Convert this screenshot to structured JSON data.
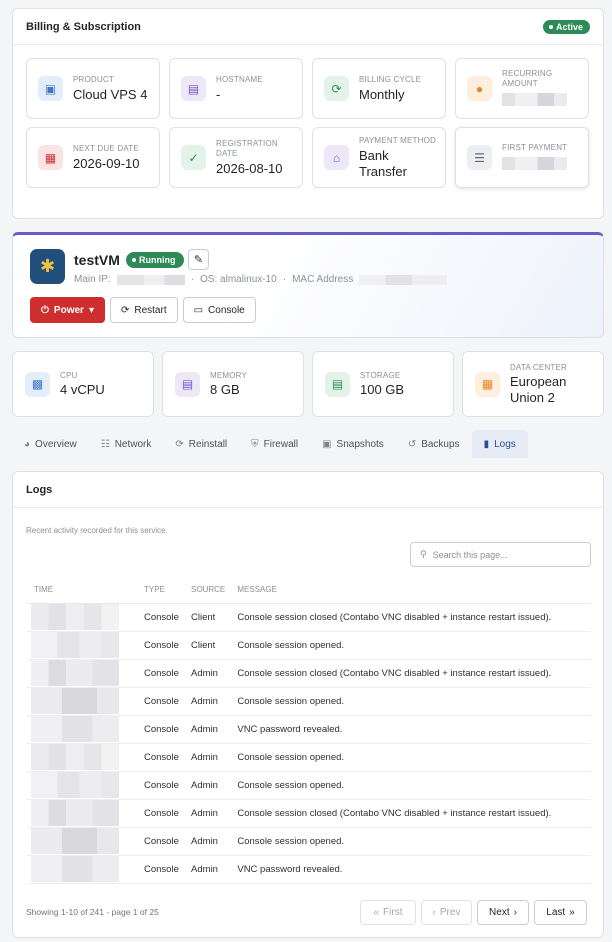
{
  "billing": {
    "title": "Billing & Subscription",
    "status": "Active",
    "items": [
      {
        "label": "PRODUCT",
        "value": "Cloud VPS 4",
        "icon": "cube-icon"
      },
      {
        "label": "HOSTNAME",
        "value": "-",
        "icon": "server-icon"
      },
      {
        "label": "BILLING CYCLE",
        "value": "Monthly",
        "icon": "refresh-icon"
      },
      {
        "label": "RECURRING AMOUNT",
        "value": "",
        "icon": "coins-icon"
      },
      {
        "label": "NEXT DUE DATE",
        "value": "2026-09-10",
        "icon": "calendar-icon"
      },
      {
        "label": "REGISTRATION DATE",
        "value": "2026-08-10",
        "icon": "calendar-check-icon"
      },
      {
        "label": "PAYMENT METHOD",
        "value": "Bank Transfer",
        "icon": "bank-icon"
      },
      {
        "label": "FIRST PAYMENT",
        "value": "",
        "icon": "receipt-icon"
      }
    ]
  },
  "vm": {
    "name": "testVM",
    "status": "Running",
    "main_ip_label": "Main IP:",
    "os_label": "OS: almalinux-10",
    "mac_label": "MAC Address",
    "power_label": "Power",
    "restart_label": "Restart",
    "console_label": "Console"
  },
  "specs": [
    {
      "label": "CPU",
      "value": "4 vCPU"
    },
    {
      "label": "MEMORY",
      "value": "8 GB"
    },
    {
      "label": "STORAGE",
      "value": "100 GB"
    },
    {
      "label": "DATA CENTER",
      "value": "European Union 2"
    }
  ],
  "tabs": [
    "Overview",
    "Network",
    "Reinstall",
    "Firewall",
    "Snapshots",
    "Backups",
    "Logs"
  ],
  "active_tab": "Logs",
  "logs": {
    "title": "Logs",
    "subtitle": "Recent activity recorded for this service.",
    "search_placeholder": "Search this page...",
    "columns": [
      "TIME",
      "TYPE",
      "SOURCE",
      "MESSAGE"
    ],
    "rows": [
      {
        "type": "Console",
        "source": "Client",
        "message": "Console session closed (Contabo VNC disabled + instance restart issued)."
      },
      {
        "type": "Console",
        "source": "Client",
        "message": "Console session opened."
      },
      {
        "type": "Console",
        "source": "Admin",
        "message": "Console session closed (Contabo VNC disabled + instance restart issued)."
      },
      {
        "type": "Console",
        "source": "Admin",
        "message": "Console session opened."
      },
      {
        "type": "Console",
        "source": "Admin",
        "message": "VNC password revealed."
      },
      {
        "type": "Console",
        "source": "Admin",
        "message": "Console session opened."
      },
      {
        "type": "Console",
        "source": "Admin",
        "message": "Console session opened."
      },
      {
        "type": "Console",
        "source": "Admin",
        "message": "Console session closed (Contabo VNC disabled + instance restart issued)."
      },
      {
        "type": "Console",
        "source": "Admin",
        "message": "Console session opened."
      },
      {
        "type": "Console",
        "source": "Admin",
        "message": "VNC password revealed."
      }
    ],
    "pagination_text": "Showing 1-10 of 241 - page 1 of 25",
    "first_label": "First",
    "prev_label": "Prev",
    "next_label": "Next",
    "last_label": "Last"
  }
}
